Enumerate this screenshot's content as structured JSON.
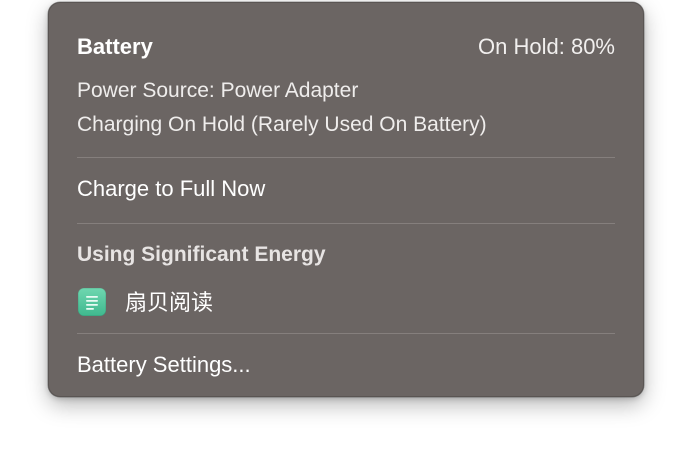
{
  "menu": {
    "title": "Battery",
    "status": "On Hold: 80%",
    "power_source": "Power Source: Power Adapter",
    "charging_state": "Charging On Hold (Rarely Used On Battery)",
    "charge_now_label": "Charge to Full Now",
    "energy_section_title": "Using Significant Energy",
    "energy_apps": [
      {
        "name": "扇贝阅读",
        "icon": "notes-app-icon",
        "icon_color": "#4cc79c"
      }
    ],
    "settings_label": "Battery Settings..."
  }
}
